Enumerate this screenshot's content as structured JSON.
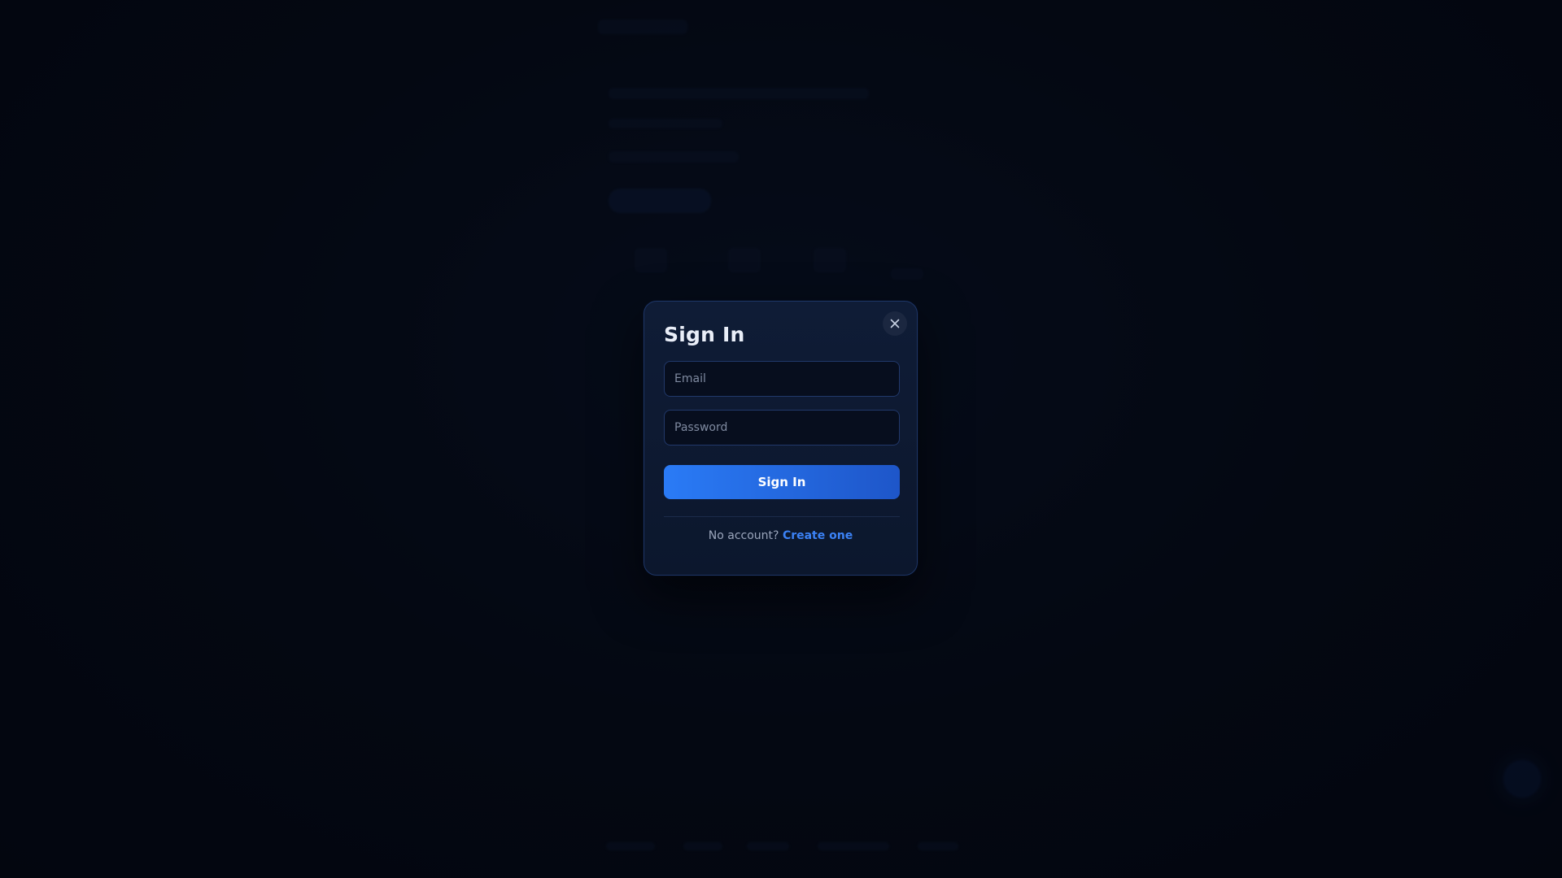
{
  "modal": {
    "title": "Sign In",
    "close_icon": "close-icon",
    "email": {
      "value": "",
      "placeholder": "Email"
    },
    "password": {
      "value": "",
      "placeholder": "Password"
    },
    "submit_label": "Sign In",
    "footer_prompt": "No account?",
    "footer_link": "Create one"
  },
  "colors": {
    "background": "#050a17",
    "modal_background": "#0f1c36",
    "modal_border": "#1d3566",
    "accent": "#2a7bf6",
    "link": "#3b82f6",
    "title_text": "#e9eef8",
    "muted_text": "#9aa5bb"
  }
}
